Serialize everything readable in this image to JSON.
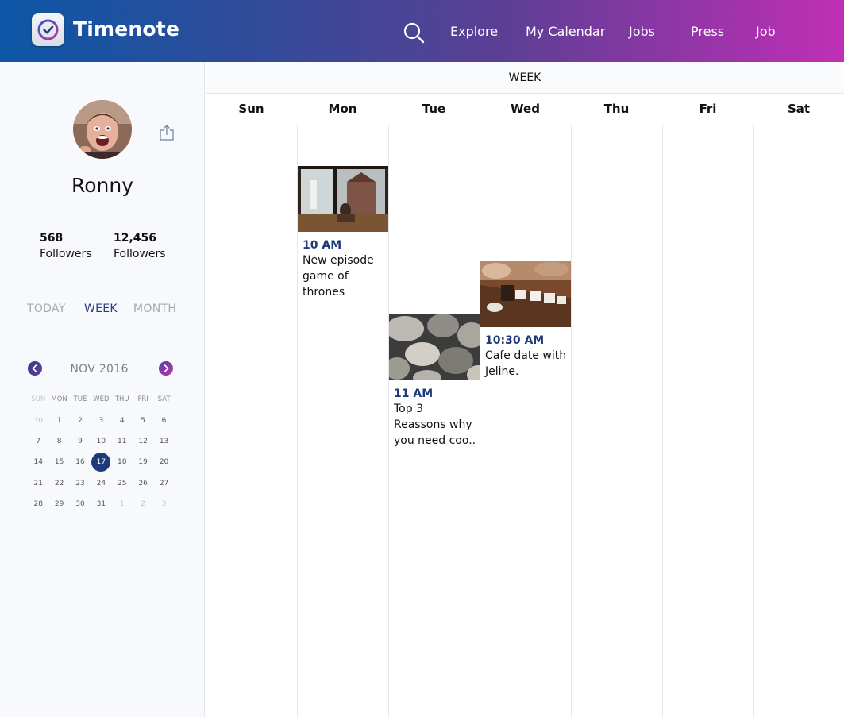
{
  "app": {
    "brand": "Timenote"
  },
  "nav": {
    "items": [
      {
        "label": "Explore"
      },
      {
        "label": "My Calendar"
      },
      {
        "label": "Jobs"
      },
      {
        "label": "Press"
      },
      {
        "label": "Job"
      }
    ],
    "search_icon": "search-icon"
  },
  "profile": {
    "name": "Ronny",
    "stats": [
      {
        "value": "568",
        "label": "Followers"
      },
      {
        "value": "12,456",
        "label": "Followers"
      }
    ]
  },
  "view_tabs": [
    {
      "label": "TODAY",
      "active": false
    },
    {
      "label": "WEEK",
      "active": true
    },
    {
      "label": "MONTH",
      "active": false
    }
  ],
  "mini_calendar": {
    "month_label": "NOV 2016",
    "weekdays": [
      "SUN",
      "MON",
      "TUE",
      "WED",
      "THU",
      "FRI",
      "SAT"
    ],
    "weeks": [
      [
        "30",
        "1",
        "2",
        "3",
        "4",
        "5",
        "6"
      ],
      [
        "7",
        "8",
        "9",
        "10",
        "11",
        "12",
        "13"
      ],
      [
        "14",
        "15",
        "16",
        "17",
        "18",
        "19",
        "20"
      ],
      [
        "21",
        "22",
        "23",
        "24",
        "25",
        "26",
        "27"
      ],
      [
        "28",
        "29",
        "30",
        "31",
        "1",
        "2",
        "3"
      ]
    ],
    "selected": "17"
  },
  "week_view": {
    "label": "WEEK",
    "days": [
      "Sun",
      "Mon",
      "Tue",
      "Wed",
      "Thu",
      "Fri",
      "Sat"
    ],
    "events": [
      {
        "day": "Mon",
        "time": "10 AM",
        "title": "New episode game of thrones"
      },
      {
        "day": "Tue",
        "time": "11 AM",
        "title": "Top 3 Reassons why you need coo.."
      },
      {
        "day": "Wed",
        "time": "10:30 AM",
        "title": "Cafe date with Jeline."
      }
    ]
  },
  "colors": {
    "header_gradient_start": "#0c57a6",
    "header_gradient_end": "#c02fb4",
    "accent": "#1f3a7c"
  }
}
